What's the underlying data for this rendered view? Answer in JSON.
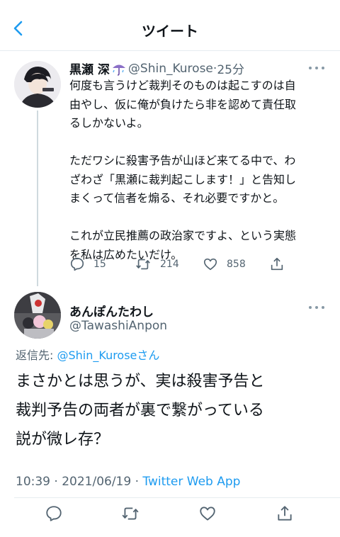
{
  "header": {
    "title": "ツイート"
  },
  "parent_tweet": {
    "name": "黒瀬 深",
    "handle": "@Shin_Kurose",
    "time": "25分",
    "text_lines": [
      "何度も言うけど裁判そのものは起こすのは自",
      "由やし、仮に俺が負けたら非を認めて責任取",
      "るしかないよ。",
      "",
      "ただワシに殺害予告が山ほど来てる中で、わ",
      "ざわざ「黒瀬に裁判起こします！」と告知し",
      "まくって信者を煽る、それ必要ですかと。",
      "",
      "これが立民推薦の政治家ですよ、という実態",
      "を私は広めたいだけ。"
    ],
    "replies": "15",
    "retweets": "214",
    "likes": "858"
  },
  "main_tweet": {
    "name": "あんぽんたわし",
    "handle": "@TawashiAnpon",
    "reply_prefix": "返信先: ",
    "reply_mention": "@Shin_Kuroseさん",
    "text_lines": [
      "まさかとは思うが、実は殺害予告と",
      "裁判予告の両者が裏で繋がっている",
      "説が微レ存？"
    ],
    "timestamp": "10:39 · 2021/06/19 · ",
    "client": "Twitter Web App"
  },
  "colors": {
    "accent": "#1d9bf0",
    "muted": "#536471",
    "text": "#0f1419"
  },
  "icons": [
    "back-icon",
    "umbrella-rain-icon",
    "more-icon",
    "reply-icon",
    "retweet-icon",
    "like-icon",
    "share-icon"
  ]
}
